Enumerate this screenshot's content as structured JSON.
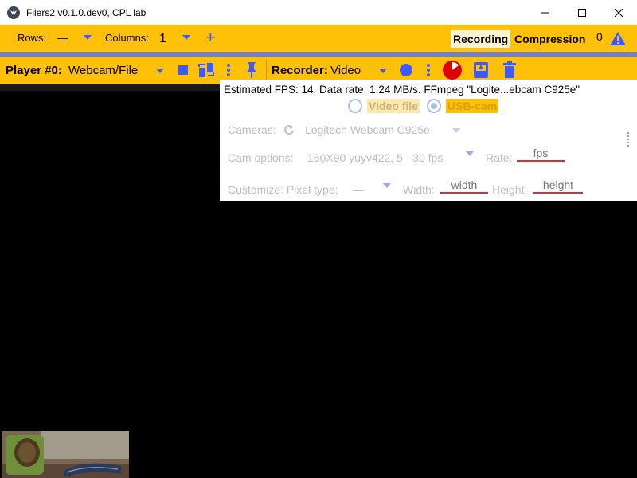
{
  "window": {
    "title": "Filers2 v0.1.0.dev0, CPL lab"
  },
  "toolbar1": {
    "rows_label": "Rows:",
    "rows_value": "—",
    "columns_label": "Columns:",
    "columns_value": "1",
    "add_icon": "plus-icon",
    "tabs": [
      "Recording",
      "Compression"
    ],
    "active_tab": "Recording",
    "warning_count": "0"
  },
  "toolbar2": {
    "player_label": "Player #0:",
    "player_source": "Webcam/File",
    "recorder_label": "Recorder:",
    "recorder_type": "Video",
    "icons": [
      "stop-icon",
      "swap-icon",
      "more-vert-icon",
      "pin-icon",
      "record-dot-icon",
      "more-vert-icon",
      "disk-usage-icon",
      "save-icon",
      "delete-icon"
    ]
  },
  "panel": {
    "status_text": "Estimated FPS: 14. Data rate: 1.24 MB/s. FFmpeg \"Logite...ebcam C925e\"",
    "source_options": [
      "Video file",
      "USB-cam"
    ],
    "selected_source": "USB-cam",
    "cameras_label": "Cameras:",
    "camera_value": "Logitech Webcam C925e",
    "cam_options_label": "Cam options:",
    "cam_options_value": "160X90 yuyv422, 5 - 30 fps",
    "rate_label": "Rate:",
    "rate_placeholder": "fps",
    "pixel_type_label": "Customize: Pixel type:",
    "pixel_type_value": "—",
    "width_label": "Width:",
    "width_placeholder": "width",
    "height_label": "Height:",
    "height_placeholder": "height"
  },
  "colors": {
    "toolbar": "#ffc107",
    "accent_blue": "#3d5afe",
    "stripe": "#6f7fd1",
    "record_red": "#e00000",
    "underline_red": "#d32f2f"
  }
}
